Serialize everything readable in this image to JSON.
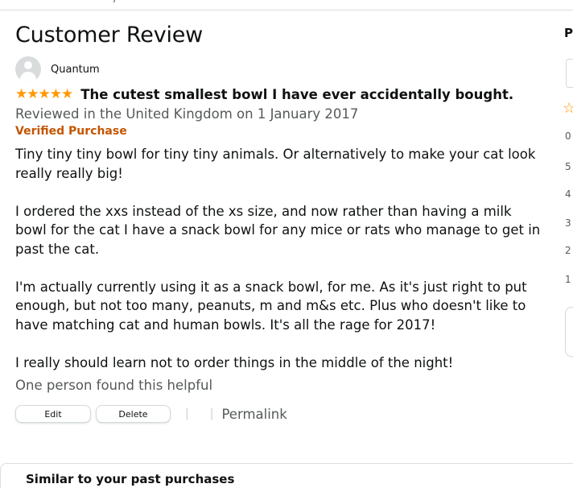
{
  "review": {
    "page_title": "Customer Review",
    "reviewer_name": "Quantum",
    "rating_stars": "★★★★★",
    "rating": 5,
    "headline": "The cutest smallest bowl I have ever accidentally bought.",
    "meta": "Reviewed in the United Kingdom on 1 January 2017",
    "verified": "Verified Purchase",
    "body": [
      "Tiny tiny tiny bowl for tiny tiny animals. Or alternatively to make your cat look really really big!",
      "I ordered the xxs instead of the xs size, and now rather than having a milk bowl for the cat I have a snack bowl for any mice or rats who manage to get in past the cat.",
      "I'm actually currently using it as a snack bowl, for me. As it's just right to put enough, but not too many, peanuts, m and m&s etc. Plus who doesn't like to have matching cat and human bowls. It's all the rage for 2017!",
      "I really should learn not to order things in the middle of the night!"
    ],
    "helpful": "One person found this helpful"
  },
  "actions": {
    "edit_label": "Edit",
    "delete_label": "Delete",
    "separator": "|",
    "permalink_label": "Permalink"
  },
  "similar": {
    "title": "Similar to your past purchases"
  },
  "right_panel": {
    "title_fragment": "P",
    "star_icon": "☆",
    "numbers": [
      "0",
      "5",
      "4",
      "3",
      "2",
      "1"
    ]
  },
  "colors": {
    "star": "#ff9900",
    "verified": "#c45500",
    "muted_text": "#565959"
  },
  "icons": {
    "avatar": "user-avatar-icon",
    "rating": "star-icon"
  }
}
